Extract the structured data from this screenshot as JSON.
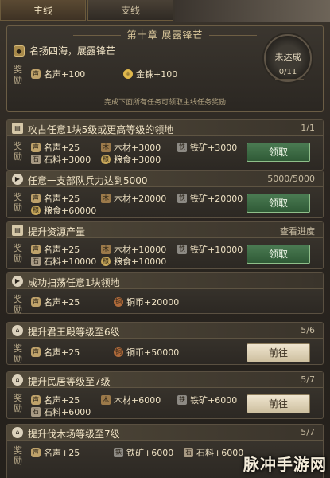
{
  "tabs": [
    {
      "label": "主线"
    },
    {
      "label": "支线"
    }
  ],
  "chapter": {
    "title": "第十章 展露锋芒",
    "name": "名扬四海，展露锋芒",
    "reward_label": "奖励",
    "rewards": [
      {
        "icon": "fame-icon",
        "text": "名声+100"
      },
      {
        "icon": "gold-icon",
        "text": "金铢+100"
      }
    ],
    "note": "完成下面所有任务可领取主线任务奖励",
    "status": "未达成",
    "progress": "0/11",
    "progress_fraction": 0
  },
  "quests": [
    {
      "title": "攻占任意1块5级或更高等级的领地",
      "progress": "1/1",
      "icon": "book-icon",
      "rewards": [
        {
          "icon": "fame-icon",
          "text": "名声+25"
        },
        {
          "icon": "wood-icon",
          "text": "木材+3000"
        },
        {
          "icon": "iron-icon",
          "text": "铁矿+3000"
        },
        {
          "icon": "stone-icon",
          "text": "石料+3000"
        },
        {
          "icon": "grain-icon",
          "text": "粮食+3000"
        }
      ],
      "button": "领取",
      "button_type": "claim"
    },
    {
      "title": "任意一支部队兵力达到5000",
      "progress": "5000/5000",
      "icon": "play-icon",
      "rewards": [
        {
          "icon": "fame-icon",
          "text": "名声+25"
        },
        {
          "icon": "wood-icon",
          "text": "木材+20000"
        },
        {
          "icon": "iron-icon",
          "text": "铁矿+20000"
        },
        {
          "icon": "grain-icon",
          "text": "粮食+60000"
        }
      ],
      "button": "领取",
      "button_type": "claim"
    },
    {
      "title": "提升资源产量",
      "progress": "查看进度",
      "icon": "book-icon",
      "rewards": [
        {
          "icon": "fame-icon",
          "text": "名声+25"
        },
        {
          "icon": "wood-icon",
          "text": "木材+10000"
        },
        {
          "icon": "iron-icon",
          "text": "铁矿+10000"
        },
        {
          "icon": "stone-icon",
          "text": "石料+10000"
        },
        {
          "icon": "grain-icon",
          "text": "粮食+10000"
        }
      ],
      "button": "领取",
      "button_type": "claim"
    },
    {
      "title": "成功扫荡任意1块领地",
      "progress": "",
      "icon": "play-icon",
      "rewards": [
        {
          "icon": "fame-icon",
          "text": "名声+25"
        },
        {
          "icon": "copper-icon",
          "text": "铜币+20000"
        }
      ],
      "button": "",
      "button_type": "none"
    },
    {
      "title": "提升君王殿等级至6级",
      "progress": "5/6",
      "icon": "building-icon",
      "rewards": [
        {
          "icon": "fame-icon",
          "text": "名声+25"
        },
        {
          "icon": "copper-icon",
          "text": "铜币+50000"
        }
      ],
      "button": "前往",
      "button_type": "go"
    },
    {
      "title": "提升民居等级至7级",
      "progress": "5/7",
      "icon": "building-icon",
      "rewards": [
        {
          "icon": "fame-icon",
          "text": "名声+25"
        },
        {
          "icon": "wood-icon",
          "text": "木材+6000"
        },
        {
          "icon": "iron-icon",
          "text": "铁矿+6000"
        },
        {
          "icon": "stone-icon",
          "text": "石料+6000"
        }
      ],
      "button": "前往",
      "button_type": "go"
    },
    {
      "title": "提升伐木场等级至7级",
      "progress": "5/7",
      "icon": "building-icon",
      "rewards": [
        {
          "icon": "fame-icon",
          "text": "名声+25"
        },
        {
          "icon": "iron-icon",
          "text": "铁矿+6000"
        },
        {
          "icon": "stone-icon",
          "text": "石料+6000"
        }
      ],
      "button": "",
      "button_type": "none"
    }
  ],
  "watermark": "脉冲手游网"
}
